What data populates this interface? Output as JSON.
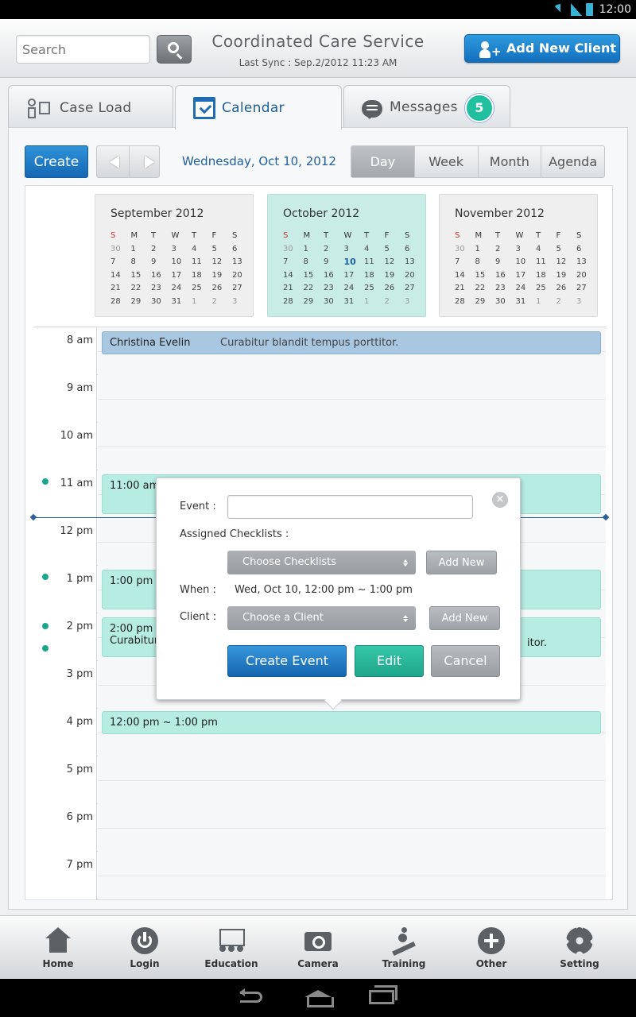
{
  "status_bar": {
    "time": "12:00"
  },
  "header": {
    "search_placeholder": "Search",
    "app_title": "Coordinated Care Service",
    "last_sync": "Last Sync : Sep.2/2012 11:23 AM",
    "add_client_label": "Add New Client"
  },
  "tabs": [
    {
      "label": "Case Load",
      "icon": "case-load-icon"
    },
    {
      "label": "Calendar",
      "icon": "calendar-icon",
      "active": true
    },
    {
      "label": "Messages",
      "icon": "messages-icon",
      "badge": "5"
    }
  ],
  "toolbar": {
    "create_label": "Create",
    "current_date": "Wednesday, Oct 10, 2012",
    "views": [
      "Day",
      "Week",
      "Month",
      "Agenda"
    ],
    "active_view": "Day"
  },
  "mini_calendars": [
    {
      "title": "September 2012",
      "current": false,
      "days": [
        "30",
        "1",
        "2",
        "3",
        "4",
        "5",
        "6",
        "7",
        "8",
        "9",
        "10",
        "11",
        "12",
        "13",
        "14",
        "15",
        "16",
        "17",
        "18",
        "19",
        "20",
        "21",
        "22",
        "23",
        "24",
        "25",
        "26",
        "27",
        "28",
        "29",
        "30",
        "31",
        "1",
        "2",
        "3"
      ],
      "other_month": [
        0,
        32,
        33,
        34
      ]
    },
    {
      "title": "October 2012",
      "current": true,
      "today_index": 10,
      "days": [
        "30",
        "1",
        "2",
        "3",
        "4",
        "5",
        "6",
        "7",
        "8",
        "9",
        "10",
        "11",
        "12",
        "13",
        "14",
        "15",
        "16",
        "17",
        "18",
        "19",
        "20",
        "21",
        "22",
        "23",
        "24",
        "25",
        "26",
        "27",
        "28",
        "29",
        "30",
        "31",
        "1",
        "2",
        "3"
      ],
      "other_month": [
        0,
        32,
        33,
        34
      ]
    },
    {
      "title": "November 2012",
      "current": false,
      "days": [
        "30",
        "1",
        "2",
        "3",
        "4",
        "5",
        "6",
        "7",
        "8",
        "9",
        "10",
        "11",
        "12",
        "13",
        "14",
        "15",
        "16",
        "17",
        "18",
        "19",
        "20",
        "21",
        "22",
        "23",
        "24",
        "25",
        "26",
        "27",
        "28",
        "29",
        "30",
        "31",
        "1",
        "2",
        "3"
      ],
      "other_month": [
        0,
        32,
        33,
        34
      ]
    }
  ],
  "weekdays": [
    "S",
    "M",
    "T",
    "W",
    "T",
    "F",
    "S"
  ],
  "hours": [
    "8 am",
    "9 am",
    "10 am",
    "11 am",
    "12 pm",
    "1 pm",
    "2 pm",
    "3 pm",
    "4 pm",
    "5 pm",
    "6 pm",
    "7 pm"
  ],
  "events": {
    "e1_name": "Christina Evelin",
    "e1_desc": "Curabitur blandit tempus porttitor.",
    "e2_time": "11:00 am",
    "e3_time": "1:00 pm",
    "e4_time": "2:00 pm",
    "e4_desc_left": "Curabitur",
    "e4_desc_right": "itor.",
    "e5_time": "12:00 pm ~ 1:00 pm"
  },
  "popup": {
    "event_label": "Event :",
    "event_value": "",
    "checklists_label": "Assigned Checklists :",
    "choose_checklists": "Choose Checklists",
    "add_new_1": "Add New",
    "when_label": "When :",
    "when_value": "Wed, Oct 10, 12:00 pm ~ 1:00 pm",
    "client_label": "Client :",
    "choose_client": "Choose a Client",
    "add_new_2": "Add New",
    "create_event": "Create Event",
    "edit": "Edit",
    "cancel": "Cancel",
    "close_glyph": "×"
  },
  "bottom_nav": [
    {
      "label": "Home",
      "icon": "home-icon"
    },
    {
      "label": "Login",
      "icon": "power-icon"
    },
    {
      "label": "Education",
      "icon": "education-icon"
    },
    {
      "label": "Camera",
      "icon": "camera-icon"
    },
    {
      "label": "Training",
      "icon": "training-icon"
    },
    {
      "label": "Other",
      "icon": "plus-circle-icon"
    },
    {
      "label": "Setting",
      "icon": "gear-icon"
    }
  ],
  "colors": {
    "accent_blue": "#1d5e9c",
    "teal": "#1fbf9f",
    "event_blue": "#a9c7e0",
    "event_teal": "#b6ece1"
  }
}
